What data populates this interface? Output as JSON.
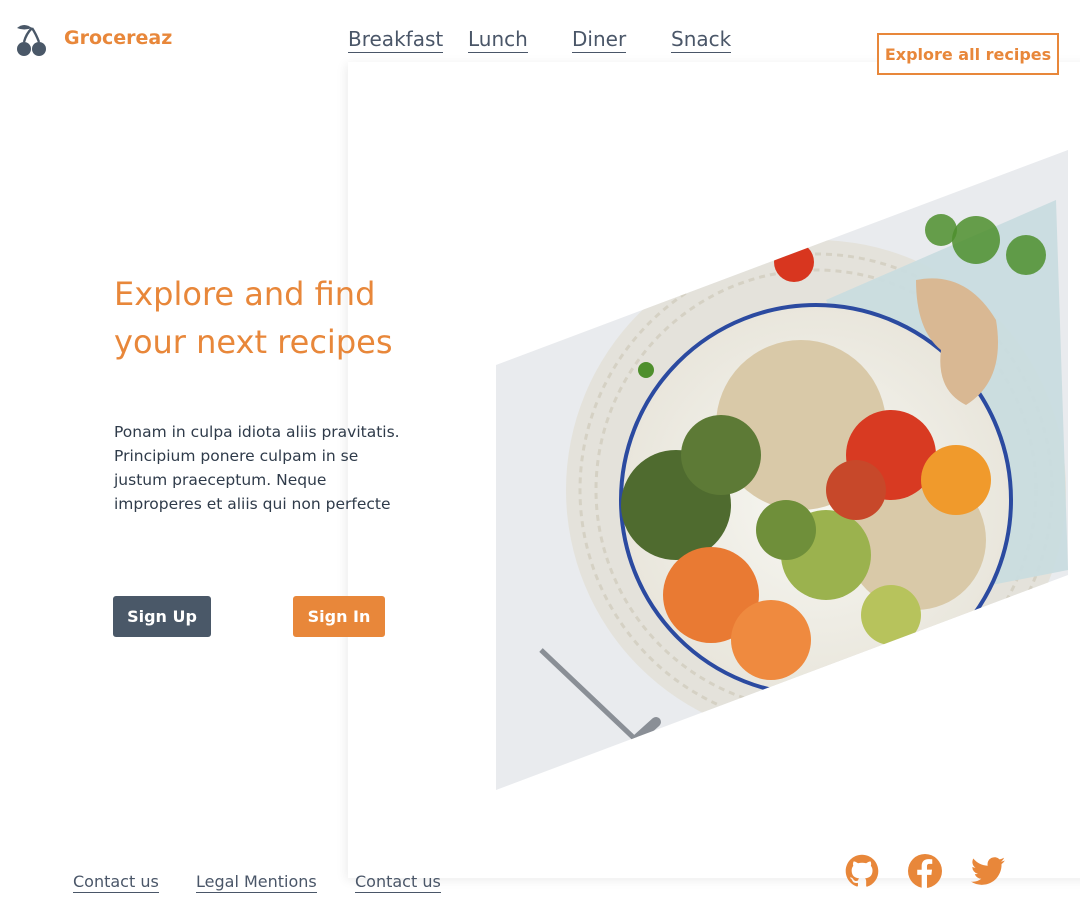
{
  "brand": {
    "name": "Grocereaz",
    "logo_icon": "cherries-icon"
  },
  "nav": {
    "items": [
      {
        "label": "Breakfast"
      },
      {
        "label": "Lunch"
      },
      {
        "label": "Diner"
      },
      {
        "label": "Snack"
      }
    ],
    "cta_label": "Explore all recipes"
  },
  "hero": {
    "title": "Explore and find your next recipes",
    "description": "Ponam in culpa idiota aliis pravitatis. Principium ponere culpam in se justum praeceptum. Neque improperes et aliis qui non perfecte",
    "signup_label": "Sign Up",
    "signin_label": "Sign In",
    "image": "food-bowl-image"
  },
  "footer": {
    "links": [
      {
        "label": "Contact us"
      },
      {
        "label": "Legal Mentions"
      },
      {
        "label": "Contact us"
      }
    ],
    "social": [
      "github-icon",
      "facebook-icon",
      "twitter-icon"
    ]
  },
  "colors": {
    "accent": "#e8873a",
    "dark": "#4a5868",
    "text": "#2f3b4a"
  }
}
